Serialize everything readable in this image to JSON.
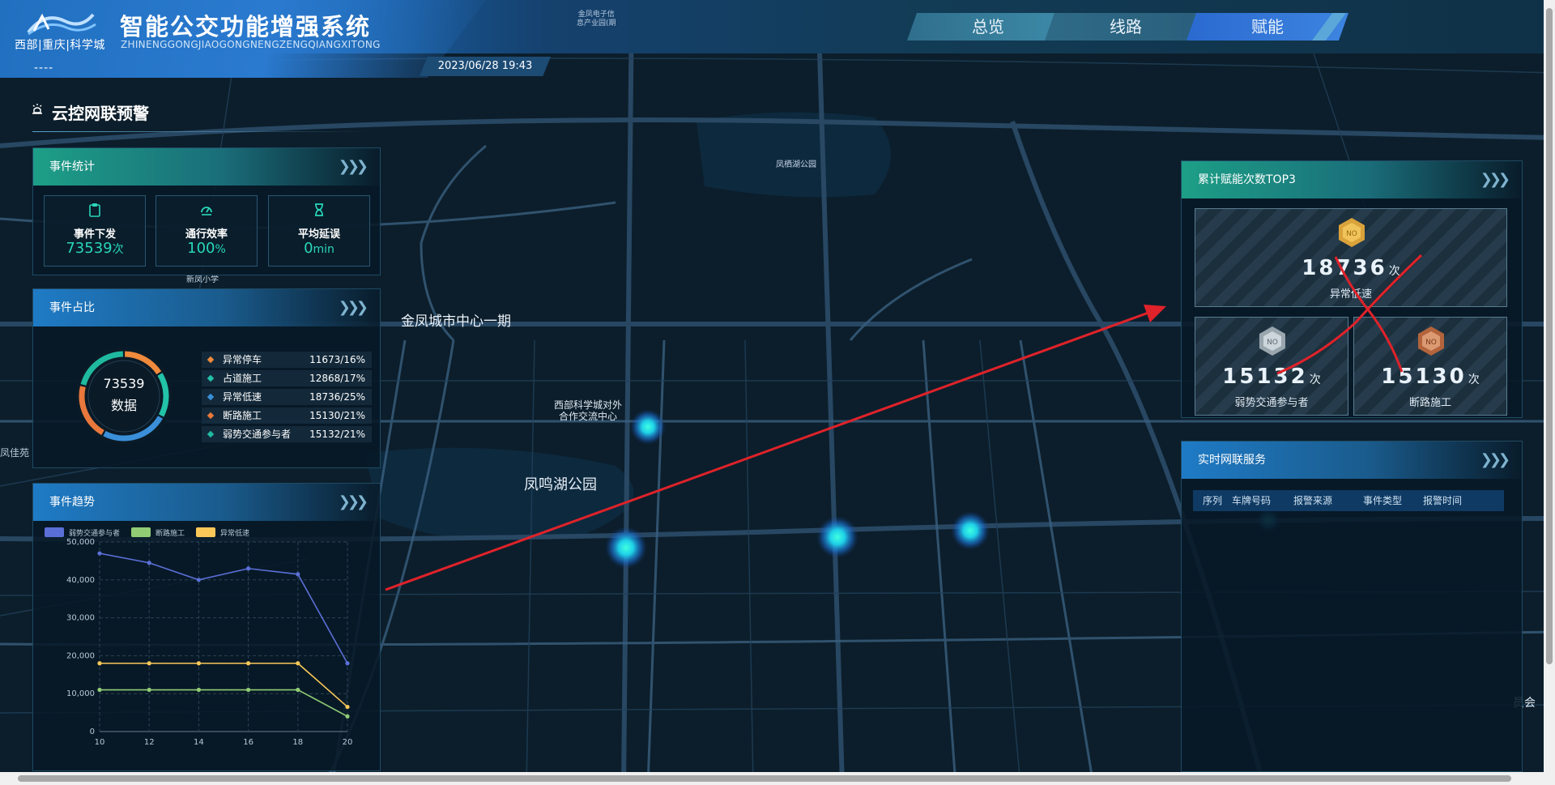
{
  "header": {
    "logo_text": "西部|重庆|科学城",
    "title": "智能公交功能增强系统",
    "pinyin": "ZHINENGGONGJIAOGONGNENGZENGQIANGXITONG",
    "dashes": "----",
    "datetime": "2023/06/28 19:43",
    "top_note_1": "金凤电子信",
    "top_note_2": "息产业园(期"
  },
  "nav": {
    "tabs": [
      {
        "label": "总览"
      },
      {
        "label": "线路"
      },
      {
        "label": "赋能"
      }
    ],
    "active": "赋能"
  },
  "map_labels": {
    "park_top": "凤栖湖公园",
    "school": "新凤小学",
    "city_center": "金凤城市中心一期",
    "exchange_center_1": "西部科学城对外",
    "exchange_center_2": "合作交流中心",
    "lake_park": "凤鸣湖公园",
    "left_edge": "凤佳苑",
    "right_edge": "员会"
  },
  "section": {
    "title": "云控网联预警"
  },
  "event_stats": {
    "title": "事件统计",
    "cards": [
      {
        "icon": "clipboard-icon",
        "label": "事件下发",
        "value": "73539",
        "unit": "次"
      },
      {
        "icon": "gauge-icon",
        "label": "通行效率",
        "value": "100",
        "unit": "%"
      },
      {
        "icon": "hourglass-icon",
        "label": "平均延误",
        "value": "0",
        "unit": "min"
      }
    ]
  },
  "event_share": {
    "title": "事件占比",
    "center_value": "73539",
    "center_label": "数据",
    "items": [
      {
        "name": "异常停车",
        "value": "11673/16%",
        "color": "#f08a3c",
        "share": 16
      },
      {
        "name": "占道施工",
        "value": "12868/17%",
        "color": "#22c3a8",
        "share": 17
      },
      {
        "name": "异常低速",
        "value": "18736/25%",
        "color": "#3a8fd8",
        "share": 25
      },
      {
        "name": "断路施工",
        "value": "15130/21%",
        "color": "#e8783c",
        "share": 21
      },
      {
        "name": "弱势交通参与者",
        "value": "15132/21%",
        "color": "#1fb99f",
        "share": 21
      }
    ]
  },
  "event_trend": {
    "title": "事件趋势"
  },
  "chart_data": {
    "type": "line",
    "x": [
      10,
      12,
      14,
      16,
      18,
      20
    ],
    "series": [
      {
        "name": "弱势交通参与者",
        "color": "#5b6fd8",
        "values": [
          47000,
          44500,
          40000,
          43000,
          41500,
          18000
        ]
      },
      {
        "name": "断路施工",
        "color": "#91cc75",
        "values": [
          11000,
          11000,
          11000,
          11000,
          11000,
          4000
        ]
      },
      {
        "name": "异常低速",
        "color": "#fac858",
        "values": [
          18000,
          18000,
          18000,
          18000,
          18000,
          6500
        ]
      }
    ],
    "y_ticks": [
      "0",
      "10,000",
      "20,000",
      "30,000",
      "40,000",
      "50,000"
    ],
    "x_ticks": [
      "10",
      "12",
      "14",
      "16",
      "18",
      "20"
    ],
    "ylim": [
      0,
      50000
    ],
    "xlim": [
      10,
      20
    ],
    "grid": true,
    "legend": "top-left"
  },
  "top3": {
    "title": "累计赋能次数TOP3",
    "items": [
      {
        "rank": 1,
        "value": "18736",
        "unit": "次",
        "label": "异常低速",
        "medal_color": "#d9a23a"
      },
      {
        "rank": 2,
        "value": "15132",
        "unit": "次",
        "label": "弱势交通参与者",
        "medal_color": "#b9c4cc"
      },
      {
        "rank": 3,
        "value": "15130",
        "unit": "次",
        "label": "断路施工",
        "medal_color": "#c47a52"
      }
    ]
  },
  "service": {
    "title": "实时网联服务",
    "columns": [
      "序列",
      "车牌号码",
      "报警来源",
      "事件类型",
      "报警时间"
    ]
  }
}
